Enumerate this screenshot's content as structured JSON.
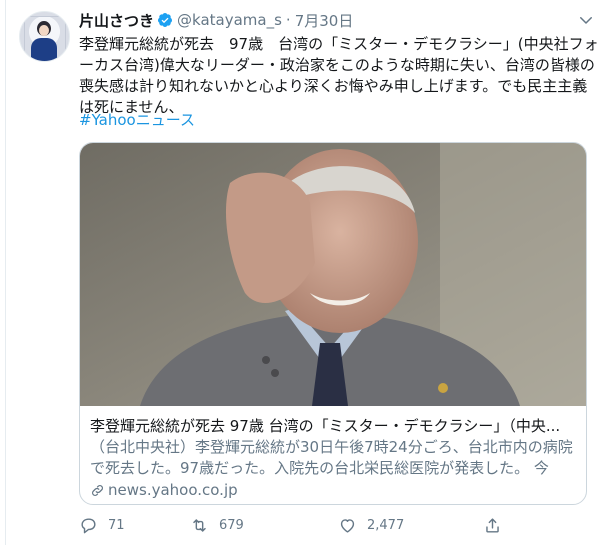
{
  "tweet": {
    "author_name": "片山さつき",
    "handle": "@katayama_s",
    "separator": "·",
    "date": "7月30日",
    "text": "李登輝元総統が死去　97歳　台湾の「ミスター・デモクラシー」(中央社フォーカス台湾)偉大なリーダー・政治家をこのような時期に失い、台湾の皆様の喪失感は計り知れないかと心より深くお悔やみ申し上げます。でも民主主義は死にません、",
    "hashtag": "#Yahooニュース"
  },
  "card": {
    "title": "李登輝元総統が死去 97歳 台湾の「ミスター・デモクラシー」（中央...",
    "description": "（台北中央社）李登輝元総統が30日午後7時24分ごろ、台北市内の病院で死去した。97歳だった。入院先の台北栄民総医院が発表した。 今年...",
    "domain": "news.yahoo.co.jp"
  },
  "actions": {
    "replies": "71",
    "retweets": "679",
    "likes": "2,477"
  },
  "icons": {
    "verified": "verified-badge-icon",
    "caret": "chevron-down-icon",
    "reply": "reply-icon",
    "retweet": "retweet-icon",
    "like": "heart-icon",
    "share": "share-icon",
    "link": "link-icon"
  },
  "colors": {
    "accent": "#1b95e0",
    "verified": "#1da1f2",
    "secondary_text": "#657786",
    "border": "#ccd6dd"
  }
}
